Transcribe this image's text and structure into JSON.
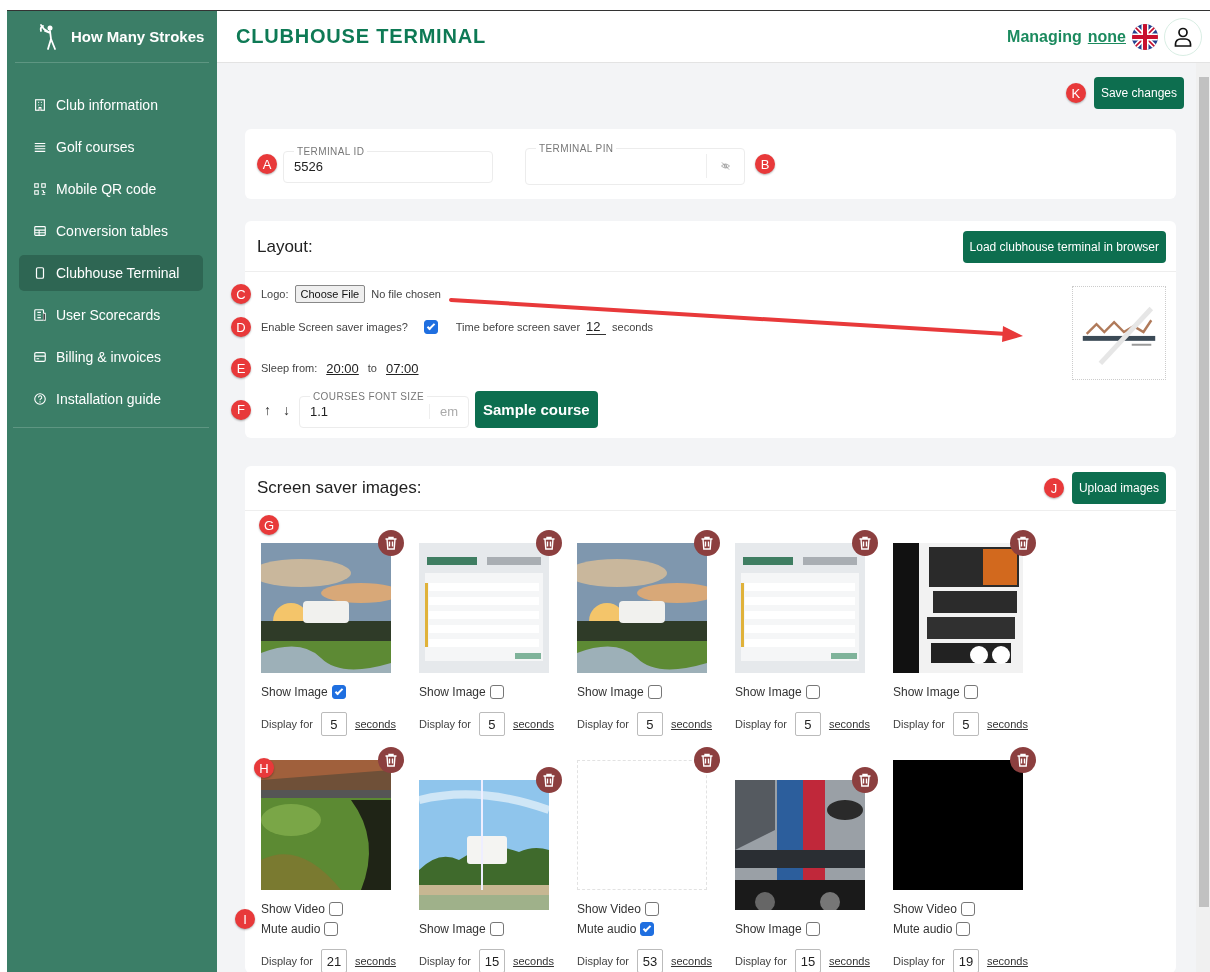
{
  "brand": "How Many Strokes",
  "sidebar": {
    "items": [
      {
        "label": "Club information",
        "selected": false
      },
      {
        "label": "Golf courses",
        "selected": false
      },
      {
        "label": "Mobile QR code",
        "selected": false
      },
      {
        "label": "Conversion tables",
        "selected": false
      },
      {
        "label": "Clubhouse Terminal",
        "selected": true
      },
      {
        "label": "User Scorecards",
        "selected": false
      },
      {
        "label": "Billing & invoices",
        "selected": false
      },
      {
        "label": "Installation guide",
        "selected": false
      }
    ]
  },
  "header": {
    "title": "CLUBHOUSE TERMINAL",
    "managing_label": "Managing",
    "managing_link": "none"
  },
  "save_button": {
    "label": "Save changes",
    "marker": "K"
  },
  "terminal": {
    "id_field": {
      "label": "TERMINAL ID",
      "value": "5526",
      "marker": "A"
    },
    "pin_field": {
      "label": "TERMINAL PIN",
      "marker": "B"
    }
  },
  "layout": {
    "title": "Layout:",
    "load_button": "Load clubhouse terminal in browser",
    "logo": {
      "marker": "C",
      "label": "Logo:",
      "button": "Choose File",
      "status": "No file chosen"
    },
    "screensaver": {
      "marker": "D",
      "label": "Enable Screen saver images?",
      "checked": true,
      "time_label": "Time before screen saver",
      "time_value": "12",
      "unit": "seconds"
    },
    "sleep": {
      "marker": "E",
      "label": "Sleep from:",
      "from": "20:00",
      "to_label": "to",
      "to": "07:00"
    },
    "font_size": {
      "marker": "F",
      "up": "↑",
      "down": "↓",
      "label": "COURSES FONT SIZE",
      "value": "1.1",
      "unit": "em",
      "button": "Sample course"
    }
  },
  "screen_saver": {
    "title": "Screen saver images:",
    "upload_button": "Upload images",
    "upload_marker": "J",
    "marker": "G",
    "items": [
      {
        "show_label": "Show Image",
        "show": true,
        "display_label": "Display for",
        "seconds": "5",
        "unit": "seconds"
      },
      {
        "show_label": "Show Image",
        "show": false,
        "display_label": "Display for",
        "seconds": "5",
        "unit": "seconds"
      },
      {
        "show_label": "Show Image",
        "show": false,
        "display_label": "Display for",
        "seconds": "5",
        "unit": "seconds"
      },
      {
        "show_label": "Show Image",
        "show": false,
        "display_label": "Display for",
        "seconds": "5",
        "unit": "seconds"
      },
      {
        "show_label": "Show Image",
        "show": false,
        "display_label": "Display for",
        "seconds": "5",
        "unit": "seconds"
      },
      {
        "kind": "video",
        "marker": "H",
        "toggles_marker": "I",
        "show_label": "Show Video",
        "show": false,
        "mute_label": "Mute audio",
        "mute": false,
        "display_label": "Display for",
        "seconds": "21",
        "unit": "seconds"
      },
      {
        "show_label": "Show Image",
        "show": false,
        "display_label": "Display for",
        "seconds": "15",
        "unit": "seconds"
      },
      {
        "kind": "video",
        "show_label": "Show Video",
        "show": false,
        "mute_label": "Mute audio",
        "mute": true,
        "display_label": "Display for",
        "seconds": "53",
        "unit": "seconds"
      },
      {
        "show_label": "Show Image",
        "show": false,
        "display_label": "Display for",
        "seconds": "15",
        "unit": "seconds"
      },
      {
        "kind": "video",
        "show_label": "Show Video",
        "show": false,
        "mute_label": "Mute audio",
        "mute": false,
        "display_label": "Display for",
        "seconds": "19",
        "unit": "seconds"
      }
    ]
  }
}
